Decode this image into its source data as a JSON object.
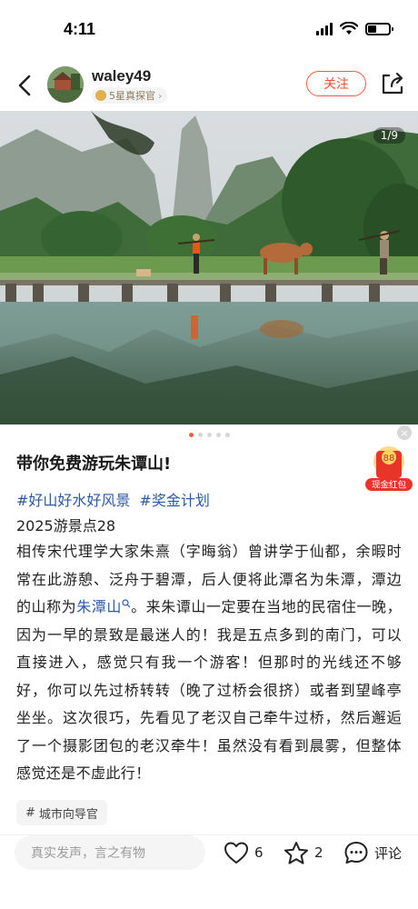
{
  "status_bar": {
    "time": "4:11"
  },
  "header": {
    "username": "waley49",
    "level_label": "5星真探官",
    "follow_label": "关注"
  },
  "photo": {
    "counter": "1/9"
  },
  "ad": {
    "amount": "88",
    "label": "现金红包",
    "close": "×"
  },
  "post": {
    "title": "带你免费游玩朱谭山!",
    "tags": [
      "#好山好水好风景",
      "#奖金计划"
    ],
    "subtitle": "2025游景点28",
    "body_before_link": "相传宋代理学大家朱熹（字晦翁）曾讲学于仙都，余暇时常在此游憩、泛舟于碧潭，后人便将此潭名为朱潭，潭边的山称为",
    "body_link": "朱潭山",
    "body_after_link": "。来朱谭山一定要在当地的民宿住一晚，因为一早的景致是最迷人的！我是五点多到的南门，可以直接进入，感觉只有我一个游客！但那时的光线还不够好，你可以先过桥转转（晚了过桥会很挤）或者到望峰亭坐坐。这次很巧，先看见了老汉自己牵牛过桥，然后邂逅了一个摄影团包的老汉牵牛！虽然没有看到晨雾，但整体感觉还是不虚此行！",
    "topic": "城市向导官"
  },
  "footer": {
    "comment_placeholder": "真实发声，言之有物",
    "like_count": "6",
    "collect_count": "2",
    "comment_label": "评论"
  },
  "colors": {
    "accent": "#ff5a3c",
    "link": "#2a5aa8"
  }
}
